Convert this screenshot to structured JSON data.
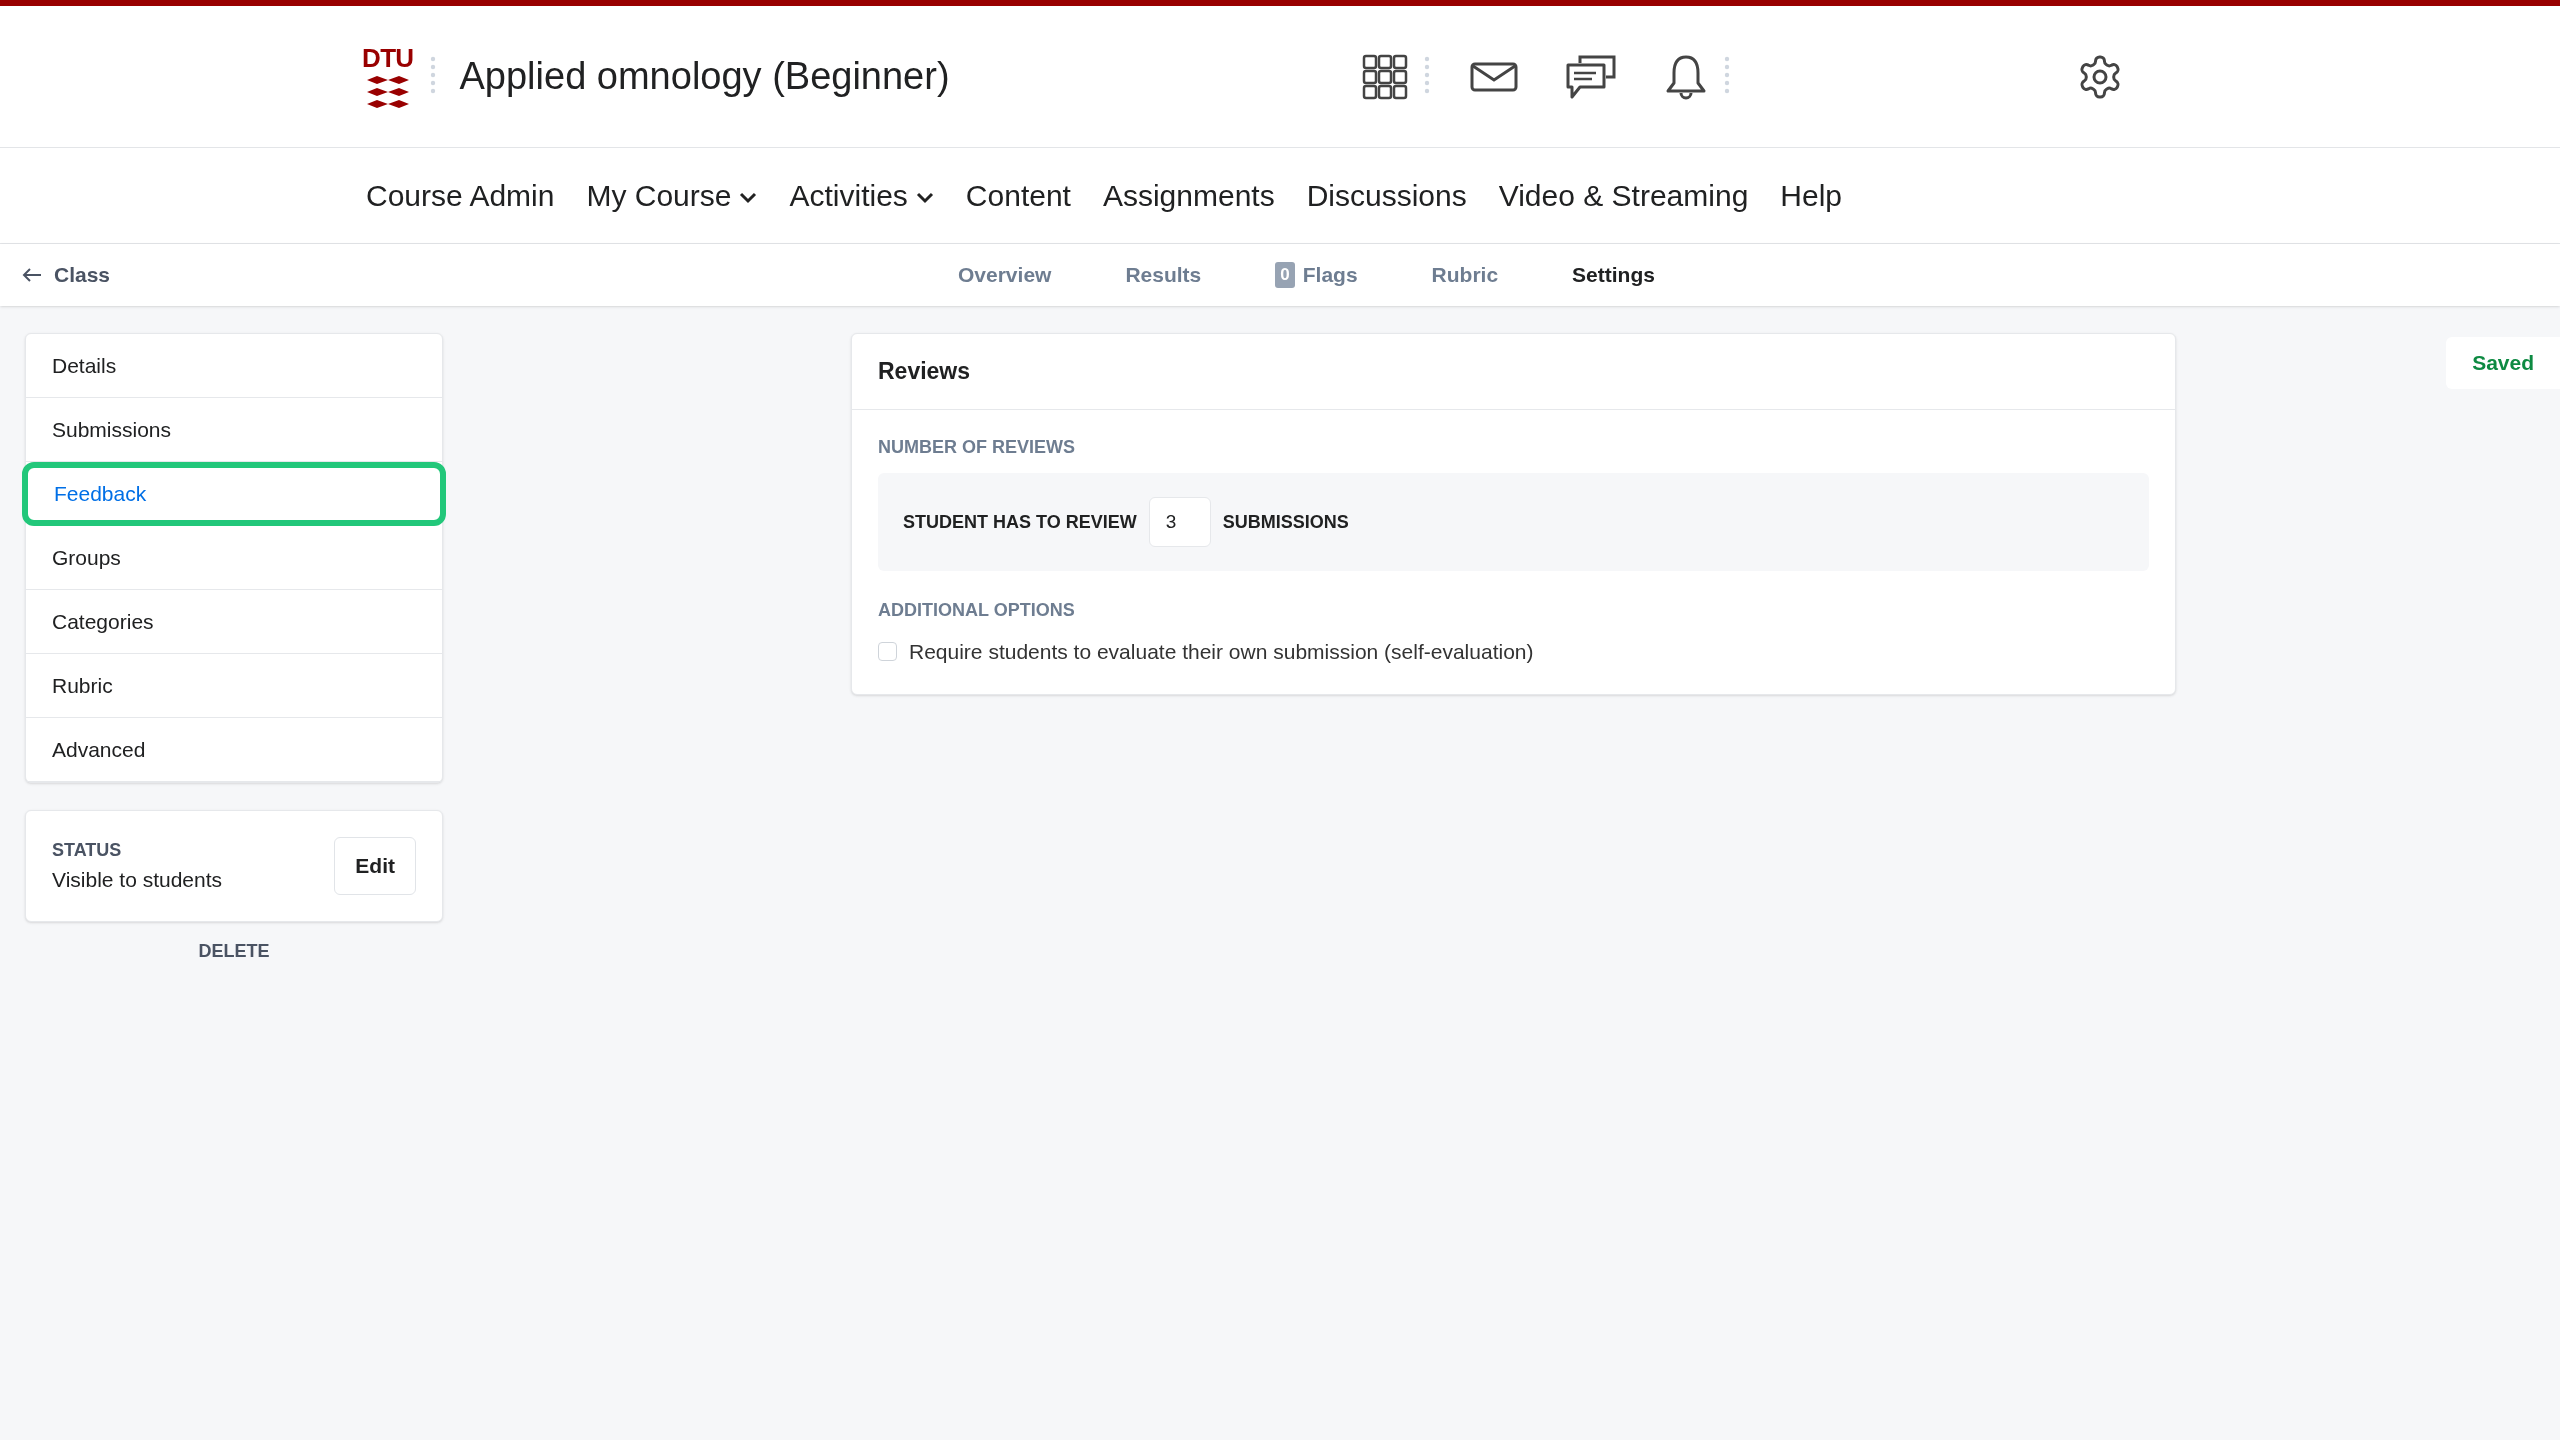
{
  "header": {
    "logo_text": "DTU",
    "course_title": "Applied omnology (Beginner)"
  },
  "nav": [
    {
      "label": "Course Admin",
      "dropdown": false
    },
    {
      "label": "My Course",
      "dropdown": true
    },
    {
      "label": "Activities",
      "dropdown": true
    },
    {
      "label": "Content",
      "dropdown": false
    },
    {
      "label": "Assignments",
      "dropdown": false
    },
    {
      "label": "Discussions",
      "dropdown": false
    },
    {
      "label": "Video & Streaming",
      "dropdown": false
    },
    {
      "label": "Help",
      "dropdown": false
    }
  ],
  "subnav": {
    "back_label": "Class",
    "tabs": [
      {
        "label": "Overview",
        "selected": false
      },
      {
        "label": "Results",
        "selected": false
      },
      {
        "label": "Flags",
        "count": "0",
        "selected": false
      },
      {
        "label": "Rubric",
        "selected": false
      },
      {
        "label": "Settings",
        "selected": true
      }
    ]
  },
  "sidebar": {
    "items": [
      {
        "label": "Details",
        "selected": false
      },
      {
        "label": "Submissions",
        "selected": false
      },
      {
        "label": "Feedback",
        "selected": true
      },
      {
        "label": "Groups",
        "selected": false
      },
      {
        "label": "Categories",
        "selected": false
      },
      {
        "label": "Rubric",
        "selected": false
      },
      {
        "label": "Advanced",
        "selected": false
      }
    ],
    "status": {
      "heading": "STATUS",
      "value": "Visible to students",
      "button": "Edit"
    },
    "delete_label": "DELETE"
  },
  "reviews": {
    "title": "Reviews",
    "number_heading": "NUMBER OF REVIEWS",
    "prefix": "STUDENT HAS TO REVIEW",
    "count": "3",
    "suffix": "SUBMISSIONS",
    "options_heading": "ADDITIONAL OPTIONS",
    "options": [
      {
        "label": "Require students to evaluate their own submission (self-evaluation)",
        "checked": false
      }
    ]
  },
  "save_status": "Saved"
}
